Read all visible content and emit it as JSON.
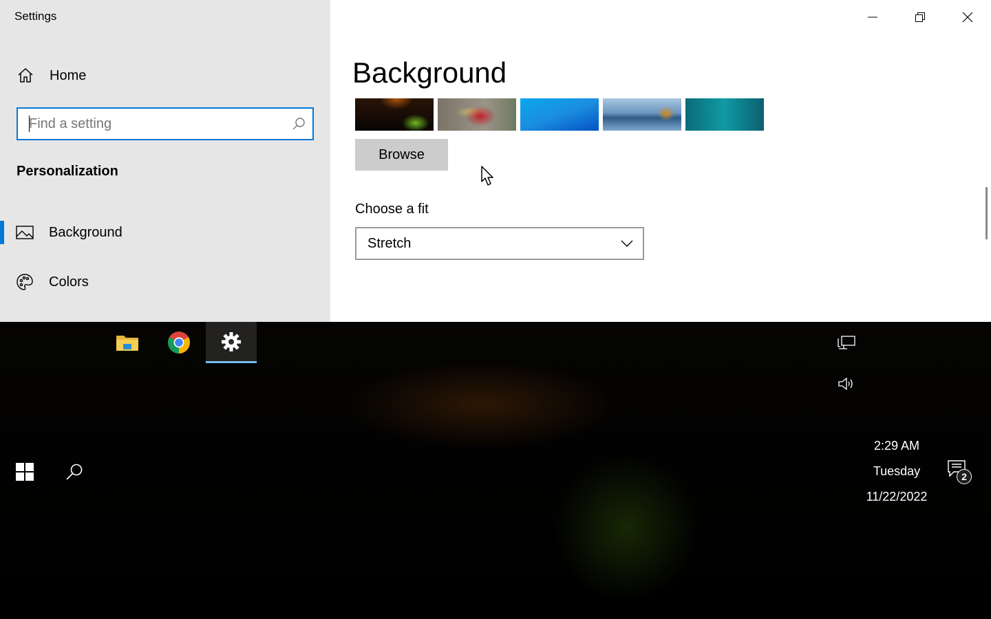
{
  "window": {
    "app_title": "Settings",
    "controls": {
      "minimize": "minimize",
      "restore": "restore",
      "close": "close"
    }
  },
  "sidebar": {
    "home_label": "Home",
    "search_placeholder": "Find a setting",
    "search_value": "",
    "section_title": "Personalization",
    "items": [
      {
        "label": "Background",
        "icon": "picture-icon",
        "selected": true
      },
      {
        "label": "Colors",
        "icon": "palette-icon",
        "selected": false
      }
    ]
  },
  "main": {
    "title": "Background",
    "recent_images": [
      {
        "name": "tent-at-night",
        "colors": [
          "#3a1a05",
          "#0e0a04",
          "#5b9c1e"
        ]
      },
      {
        "name": "food-closeup",
        "colors": [
          "#8e8478",
          "#b2202a",
          "#5f6a4e"
        ]
      },
      {
        "name": "blue-abstract",
        "colors": [
          "#0aa0e8",
          "#0567c9",
          "#1f8fdc"
        ]
      },
      {
        "name": "beach-reflection",
        "colors": [
          "#8fb5d9",
          "#2f5d88",
          "#c98a2b"
        ]
      },
      {
        "name": "underwater-teal",
        "colors": [
          "#0a7f8a",
          "#0d5d6b",
          "#12909b"
        ]
      }
    ],
    "browse_label": "Browse",
    "fit_label": "Choose a fit",
    "fit_value": "Stretch"
  },
  "taskbar": {
    "pinned_apps": [
      {
        "name": "File Explorer",
        "icon": "folder-icon",
        "active": false
      },
      {
        "name": "Google Chrome",
        "icon": "chrome-icon",
        "active": false
      },
      {
        "name": "Settings",
        "icon": "gear-icon",
        "active": true
      }
    ],
    "tray": {
      "network_icon": "network-icon",
      "volume_icon": "volume-icon"
    },
    "clock": {
      "time": "2:29 AM",
      "day": "Tuesday",
      "date": "11/22/2022"
    },
    "notifications": {
      "count": "2"
    }
  },
  "colors": {
    "accent": "#0078d7",
    "sidebar_bg": "#e6e6e6",
    "button_bg": "#cccccc",
    "taskbar_active_underline": "#76b9ed"
  }
}
